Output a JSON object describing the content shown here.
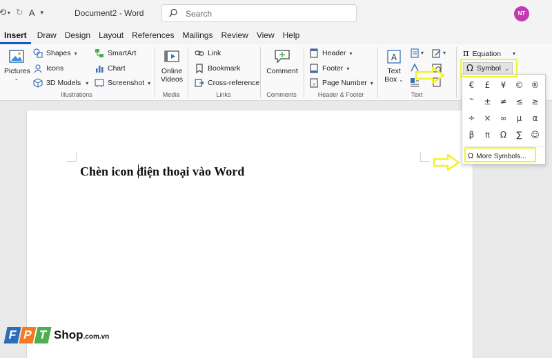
{
  "titlebar": {
    "doc_title": "Document2  -  Word",
    "search_placeholder": "Search",
    "avatar_initials": "NT"
  },
  "tabs": [
    "Insert",
    "Draw",
    "Design",
    "Layout",
    "References",
    "Mailings",
    "Review",
    "View",
    "Help"
  ],
  "ribbon": {
    "illustrations": {
      "pictures": "Pictures",
      "shapes": "Shapes",
      "icons": "Icons",
      "models3d": "3D Models",
      "smartart": "SmartArt",
      "chart": "Chart",
      "screenshot": "Screenshot",
      "label": "Illustrations"
    },
    "media": {
      "online_videos_1": "Online",
      "online_videos_2": "Videos",
      "label": "Media"
    },
    "links": {
      "link": "Link",
      "bookmark": "Bookmark",
      "crossref": "Cross-reference",
      "label": "Links"
    },
    "comments": {
      "comment": "Comment",
      "label": "Comments"
    },
    "headerfooter": {
      "header": "Header",
      "footer": "Footer",
      "pagenumber": "Page Number",
      "label": "Header & Footer"
    },
    "text": {
      "textbox_1": "Text",
      "textbox_2": "Box",
      "label": "Text"
    },
    "symbols": {
      "equation": "Equation",
      "symbol": "Symbol"
    }
  },
  "symbol_dropdown": {
    "symbols": [
      "€",
      "£",
      "¥",
      "©",
      "®",
      "™",
      "±",
      "≠",
      "≤",
      "≥",
      "÷",
      "×",
      "∞",
      "µ",
      "α",
      "β",
      "π",
      "Ω",
      "∑",
      "☺"
    ],
    "more_symbols": "More Symbols..."
  },
  "document": {
    "heading": "Chèn icon điện thoại vào Word"
  },
  "watermark": {
    "letters": [
      "F",
      "P",
      "T"
    ],
    "shop": "Shop",
    "domain": ".com.vn"
  },
  "colors": {
    "accent": "#185abd",
    "highlight": "#f2f22b",
    "avatar": "#c239b3",
    "fpt_blue": "#2a6ebb",
    "fpt_orange": "#f47920",
    "fpt_green": "#4caf50"
  }
}
